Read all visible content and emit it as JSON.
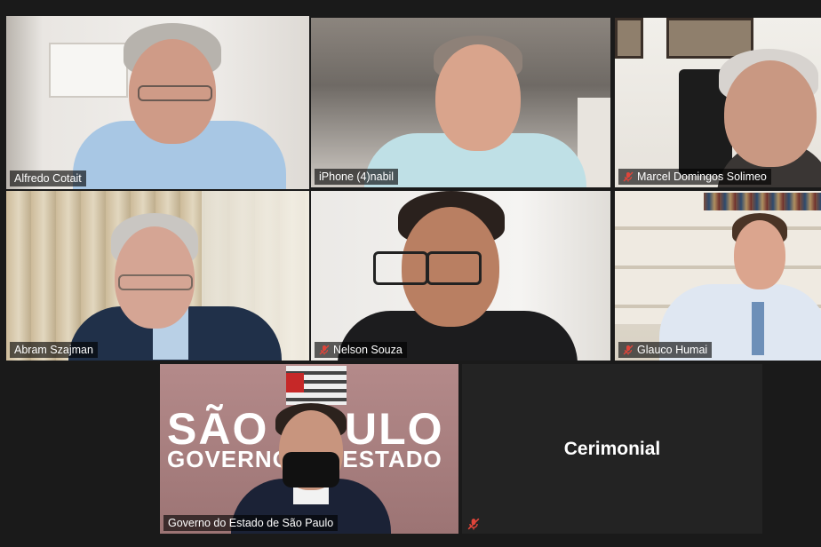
{
  "participants": [
    {
      "name": "Alfredo Cotait",
      "muted": false,
      "active_speaker": true
    },
    {
      "name": "iPhone (4)nabil",
      "muted": false,
      "active_speaker": false
    },
    {
      "name": "Marcel Domingos Solimeo",
      "muted": true,
      "active_speaker": false
    },
    {
      "name": "Abram Szajman",
      "muted": false,
      "active_speaker": false
    },
    {
      "name": "Nelson Souza",
      "muted": true,
      "active_speaker": false
    },
    {
      "name": "Glauco Humai",
      "muted": true,
      "active_speaker": false
    },
    {
      "name": "Governo do Estado de São Paulo",
      "muted": false,
      "active_speaker": false
    },
    {
      "name": "Cerimonial",
      "muted": true,
      "active_speaker": false,
      "video_off": true
    }
  ],
  "backdrop": {
    "line1": "SÃO PAULO",
    "line2": "GOVERNO DO ESTADO"
  },
  "colors": {
    "active_border": "#c5e86c",
    "muted_icon": "#e0453a"
  }
}
